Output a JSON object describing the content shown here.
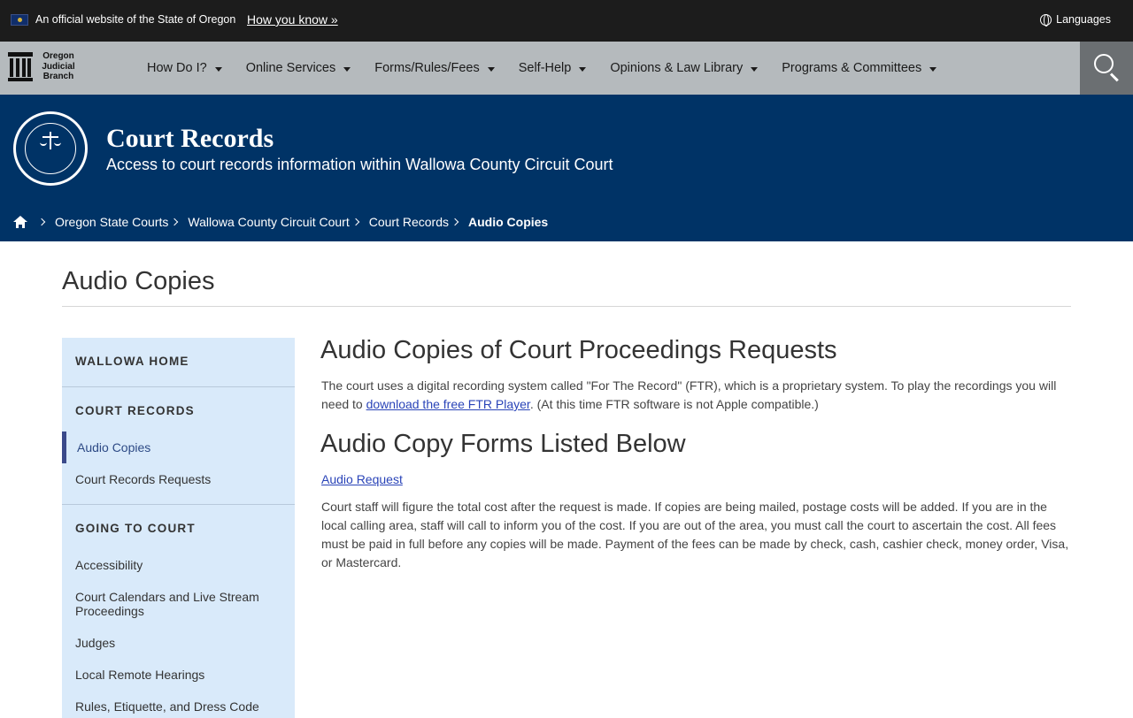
{
  "official_bar": {
    "text": "An official website of the State of Oregon",
    "how_you_know": "How you know »",
    "languages": "Languages"
  },
  "logo": {
    "line1": "Oregon",
    "line2": "Judicial",
    "line3": "Branch"
  },
  "nav": {
    "items": [
      {
        "label": "How Do I?"
      },
      {
        "label": "Online Services"
      },
      {
        "label": "Forms/Rules/Fees"
      },
      {
        "label": "Self-Help"
      },
      {
        "label": "Opinions & Law Library"
      },
      {
        "label": "Programs & Committees"
      }
    ]
  },
  "banner": {
    "title": "Court Records",
    "subtitle": "Access to court records information within Wallowa County Circuit Court"
  },
  "breadcrumb": {
    "items": [
      "Oregon State Courts",
      "Wallowa County Circuit Court",
      "Court Records"
    ],
    "current": "Audio Copies"
  },
  "page_title": "Audio Copies",
  "sidebar": {
    "sections": [
      {
        "heading": "WALLOWA HOME"
      },
      {
        "heading": "COURT RECORDS",
        "links": [
          "Audio Copies",
          "Court Records Requests"
        ]
      },
      {
        "heading": "GOING TO COURT",
        "links": [
          "Accessibility",
          "Court Calendars and Live Stream Proceedings",
          "Judges",
          "Local Remote Hearings",
          "Rules, Etiquette, and Dress Code"
        ]
      }
    ]
  },
  "main": {
    "heading1": "Audio Copies of Court Proceedings Requests",
    "intro_before": "The court uses a digital recording system called \"For The Record\" (FTR), which is a proprietary system. To play the recordings you will need to ",
    "intro_link": "download the free FTR Player",
    "intro_after": ". (At this time FTR software is not Apple compatible.)",
    "heading2": "Audio Copy Forms Listed Below",
    "form_link": "Audio Request",
    "cost_text": "Court staff will figure the total cost after the request is made. If copies are being mailed, postage costs will be added. If you are in the local calling area, staff will call to inform you of the cost. If you are out of the area, you must call the court to ascertain the cost. All fees must be paid in full before any copies will be made. Payment of the fees can be made by check, cash, cashier check, money order, Visa, or Mastercard."
  }
}
